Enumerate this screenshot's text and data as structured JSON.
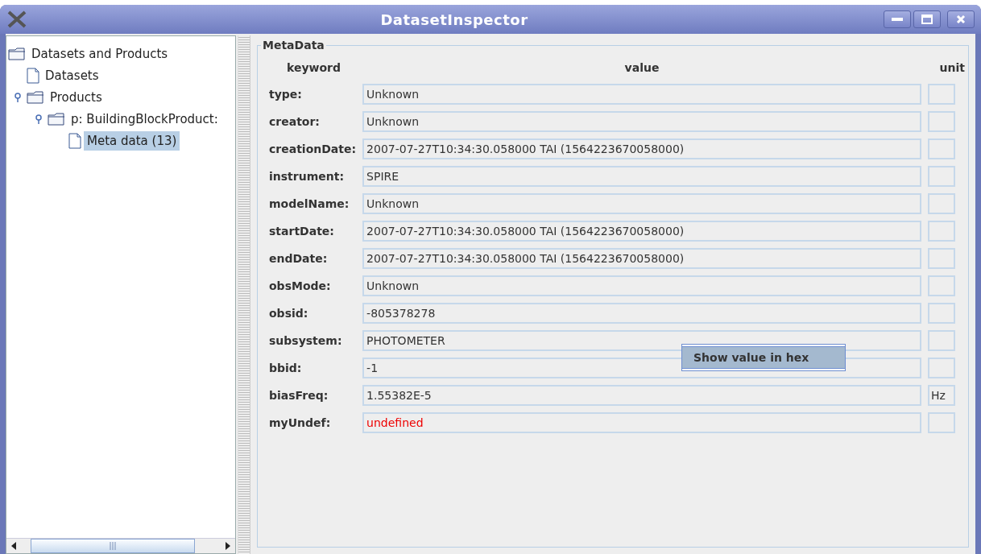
{
  "window": {
    "title": "DatasetInspector"
  },
  "tree": [
    {
      "label": "Datasets and Products",
      "kind": "folder",
      "selected": false,
      "children": [
        {
          "label": "Datasets",
          "kind": "document",
          "selected": false
        },
        {
          "label": "Products",
          "kind": "folder",
          "selected": false,
          "expanded": true,
          "children": [
            {
              "label": "p: BuildingBlockProduct:",
              "kind": "folder",
              "selected": false,
              "expanded": true,
              "children": [
                {
                  "label": "Meta data (13)",
                  "kind": "document",
                  "selected": true
                }
              ]
            }
          ]
        }
      ]
    }
  ],
  "metadata": {
    "title": "MetaData",
    "columns": [
      "keyword",
      "value",
      "unit"
    ],
    "rows": [
      {
        "keyword": "type:",
        "value": "Unknown",
        "kind": "text"
      },
      {
        "keyword": "creator:",
        "value": "Unknown",
        "kind": "text"
      },
      {
        "keyword": "creationDate:",
        "value": "2007-07-27T10:34:30.058000 TAI (1564223670058000)",
        "kind": "text"
      },
      {
        "keyword": "instrument:",
        "value": "SPIRE",
        "kind": "text"
      },
      {
        "keyword": "modelName:",
        "value": "Unknown",
        "kind": "text"
      },
      {
        "keyword": "startDate:",
        "value": "2007-07-27T10:34:30.058000 TAI (1564223670058000)",
        "kind": "text"
      },
      {
        "keyword": "endDate:",
        "value": "2007-07-27T10:34:30.058000 TAI (1564223670058000)",
        "kind": "text"
      },
      {
        "keyword": "obsMode:",
        "value": "Unknown",
        "kind": "text"
      },
      {
        "keyword": "obsid:",
        "value": "-805378278",
        "kind": "text"
      },
      {
        "keyword": "subsystem:",
        "value": "PHOTOMETER",
        "kind": "text"
      },
      {
        "keyword": "bbid:",
        "value": "-1",
        "kind": "text"
      },
      {
        "keyword": "biasFreq:",
        "value": "1.55382E-5",
        "unit": "Hz",
        "kind": "text"
      },
      {
        "keyword": "myUndef:",
        "value": "undefined",
        "kind": "undefined"
      }
    ]
  },
  "context_menu": {
    "items": [
      "Show value in hex"
    ]
  }
}
